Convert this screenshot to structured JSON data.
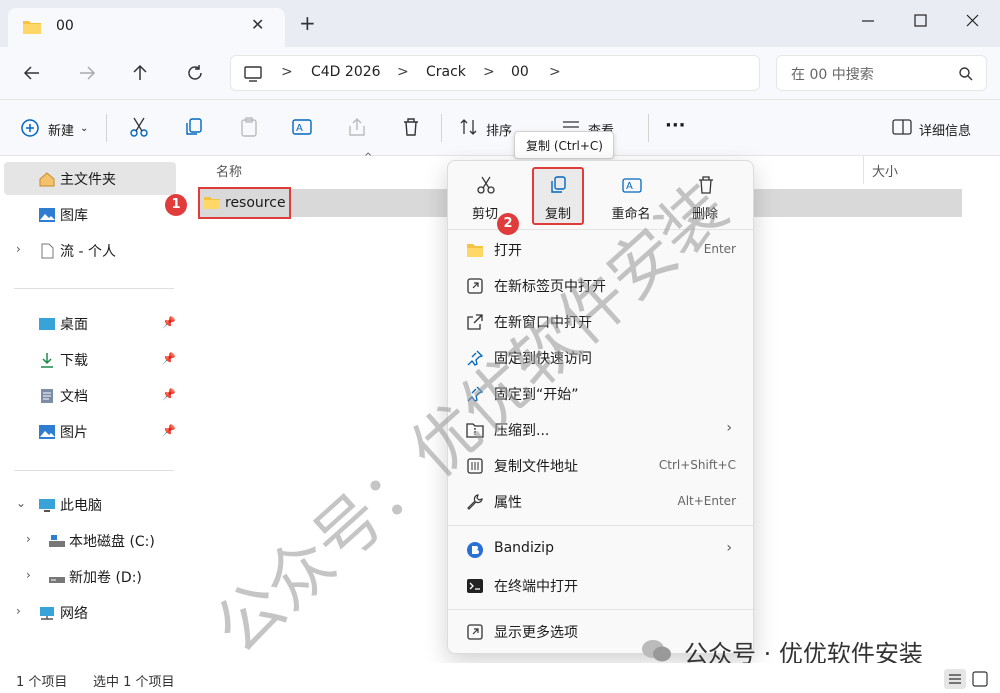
{
  "tab": {
    "title": "00",
    "close": "✕",
    "new": "+"
  },
  "address": {
    "crumbs": [
      "C4D 2026",
      "Crack",
      "00"
    ],
    "separator": ">"
  },
  "search": {
    "placeholder": "在 00 中搜索"
  },
  "toolbar": {
    "new_label": "新建",
    "sort_label": "排序",
    "view_label": "查看",
    "more": "···",
    "details_label": "详细信息"
  },
  "sidebar": {
    "home": "主文件夹",
    "gallery": "图库",
    "personal": "流 - 个人",
    "desktop": "桌面",
    "downloads": "下载",
    "documents": "文档",
    "pictures": "图片",
    "this_pc": "此电脑",
    "drive_c": "本地磁盘 (C:)",
    "drive_d": "新加卷 (D:)",
    "network": "网络"
  },
  "columns": {
    "name": "名称",
    "size": "大小"
  },
  "files": [
    {
      "name": "resource"
    }
  ],
  "status": {
    "count": "1 个项目",
    "selected": "选中 1 个项目"
  },
  "context_menu": {
    "quick_actions": [
      {
        "label": "剪切",
        "icon": "scissors-icon"
      },
      {
        "label": "复制",
        "icon": "copy-icon"
      },
      {
        "label": "重命名",
        "icon": "rename-icon"
      },
      {
        "label": "删除",
        "icon": "trash-icon"
      }
    ],
    "items": [
      {
        "label": "打开",
        "key": "Enter",
        "icon": "folder-icon"
      },
      {
        "label": "在新标签页中打开",
        "key": "",
        "icon": "new-tab-icon"
      },
      {
        "label": "在新窗口中打开",
        "key": "",
        "icon": "new-window-icon"
      },
      {
        "label": "固定到快速访问",
        "key": "",
        "icon": "pin-icon"
      },
      {
        "label": "固定到“开始”",
        "key": "",
        "icon": "pin-start-icon"
      },
      {
        "label": "压缩到...",
        "key": "",
        "icon": "zip-icon"
      },
      {
        "label": "复制文件地址",
        "key": "Ctrl+Shift+C",
        "icon": "copy-path-icon"
      },
      {
        "label": "属性",
        "key": "Alt+Enter",
        "icon": "wrench-icon"
      },
      {
        "label": "Bandizip",
        "key": "",
        "icon": "bandizip-icon"
      },
      {
        "label": "在终端中打开",
        "key": "",
        "icon": "terminal-icon"
      },
      {
        "label": "显示更多选项",
        "key": "",
        "icon": "more-options-icon"
      }
    ],
    "submenu_arrow": "›"
  },
  "tooltip": "复制 (Ctrl+C)",
  "badges": [
    "1",
    "2"
  ],
  "watermark": {
    "diagonal": "公众号：优优软件安装",
    "footer": "公众号 · 优优软件安装"
  },
  "colors": {
    "highlight_red": "#e03c3c",
    "accent_blue": "#0067c0",
    "folder_yellow": "#f5c242"
  }
}
